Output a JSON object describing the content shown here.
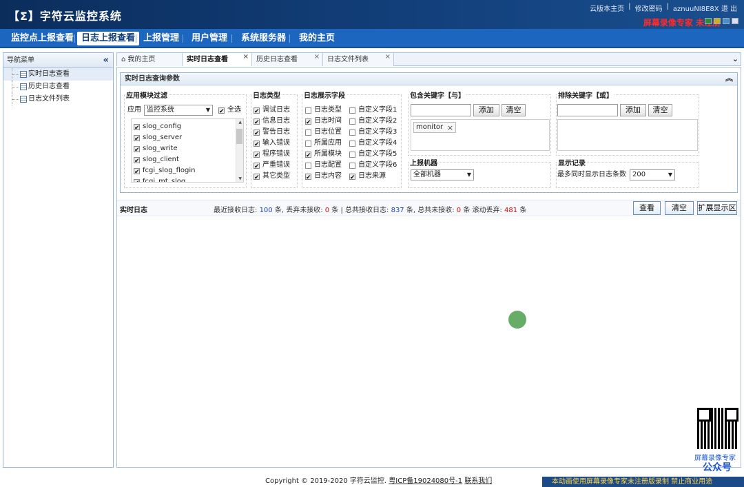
{
  "app": {
    "title": "【Σ】字符云监控系统",
    "top_links": [
      "云版本主页",
      "修改密码",
      "aznuuNI8E8X 退 出"
    ],
    "watermark": "屏幕录像专家 未注册"
  },
  "menu": [
    "监控点上报查看",
    "日志上报查看",
    "上报管理",
    "用户管理",
    "系统服务器",
    "我的主页"
  ],
  "nav": {
    "title": "导航菜单",
    "items": [
      "实时日志查看",
      "历史日志查看",
      "日志文件列表"
    ]
  },
  "tabs": [
    {
      "label": "我的主页"
    },
    {
      "label": "实时日志查看"
    },
    {
      "label": "历史日志查看"
    },
    {
      "label": "日志文件列表"
    }
  ],
  "query": {
    "title": "实时日志查询参数",
    "module_filter": {
      "legend": "应用模块过滤",
      "app_label": "应用",
      "app_value": "监控系统",
      "select_all": "全选",
      "modules": [
        "slog_config",
        "slog_server",
        "slog_write",
        "slog_client",
        "fcgi_slog_flogin",
        "fcgi_mt_slog"
      ]
    },
    "log_types": {
      "legend": "日志类型",
      "items": [
        "调试日志",
        "信息日志",
        "警告日志",
        "输入错误",
        "程序错误",
        "严重错误",
        "其它类型"
      ]
    },
    "fields": {
      "legend": "日志展示字段",
      "left": [
        "日志类型",
        "日志时间",
        "日志位置",
        "所属应用",
        "所属模块",
        "日志配置",
        "日志内容"
      ],
      "right": [
        "自定义字段1",
        "自定义字段2",
        "自定义字段3",
        "自定义字段4",
        "自定义字段5",
        "自定义字段6",
        "日志来源"
      ]
    },
    "include": {
      "legend": "包含关键字【与】",
      "add": "添加",
      "clear": "清空",
      "tag": "monitor"
    },
    "exclude": {
      "legend": "排除关键字【或】",
      "add": "添加",
      "clear": "清空"
    },
    "machine": {
      "legend": "上报机器",
      "value": "全部机器"
    },
    "display": {
      "legend": "显示记录",
      "label": "最多同时显示日志条数",
      "value": "200"
    }
  },
  "status": {
    "title": "实时日志",
    "s1": "最近接收日志: ",
    "n1": "100",
    "s2": " 条, 丢弃未接收: ",
    "n2": "0",
    "s3": " 条 | 总共接收日志: ",
    "n3": "837",
    "s4": " 条, 总共未接收: ",
    "n4": "0",
    "s5": " 条 滚动丢弃: ",
    "n5": "481",
    "s6": " 条",
    "buttons": [
      "查看",
      "清空",
      "扩展显示区"
    ]
  },
  "footer": {
    "copyright": "Copyright © 2019-2020 字符云监控.",
    "icp": "粤ICP备19024080号-1",
    "contact": "联系我们",
    "marquee": "本动画使用屏幕录像专家未注册版录制  禁止商业用途"
  },
  "qr": {
    "caption1": "屏幕录像专家",
    "caption2": "公众号"
  }
}
